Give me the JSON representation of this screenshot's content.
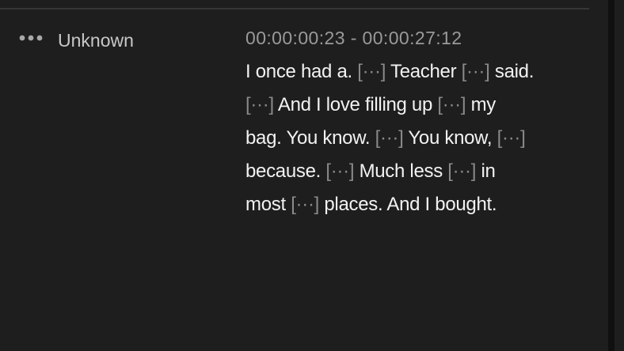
{
  "speaker": {
    "menu_icon": "more-horizontal-icon",
    "name": "Unknown"
  },
  "segment": {
    "timecode": "00:00:00:23 - 00:00:27:12",
    "lines": [
      [
        {
          "type": "text",
          "text": "I once had a. "
        },
        {
          "type": "pause",
          "text": "[···]"
        },
        {
          "type": "text",
          "text": " Teacher "
        },
        {
          "type": "pause",
          "text": "[···]"
        },
        {
          "type": "text",
          "text": " said."
        }
      ],
      [
        {
          "type": "pause",
          "text": "[···]"
        },
        {
          "type": "text",
          "text": " And I love filling up "
        },
        {
          "type": "pause",
          "text": "[···]"
        },
        {
          "type": "text",
          "text": " my"
        }
      ],
      [
        {
          "type": "text",
          "text": "bag. You know. "
        },
        {
          "type": "pause",
          "text": "[···]"
        },
        {
          "type": "text",
          "text": " You know, "
        },
        {
          "type": "pause",
          "text": "[···]"
        }
      ],
      [
        {
          "type": "text",
          "text": "because. "
        },
        {
          "type": "pause",
          "text": "[···]"
        },
        {
          "type": "text",
          "text": " Much less "
        },
        {
          "type": "pause",
          "text": "[···]"
        },
        {
          "type": "text",
          "text": " in"
        }
      ],
      [
        {
          "type": "text",
          "text": "most "
        },
        {
          "type": "pause",
          "text": "[···]"
        },
        {
          "type": "text",
          "text": " places. And I bought."
        }
      ]
    ]
  },
  "colors": {
    "background": "#1e1e1e",
    "speaker_text": "#c8c8c8",
    "timecode_text": "#9a9a9a",
    "transcript_text": "#f2f2f2",
    "pause_marker": "#8a8a8a"
  }
}
